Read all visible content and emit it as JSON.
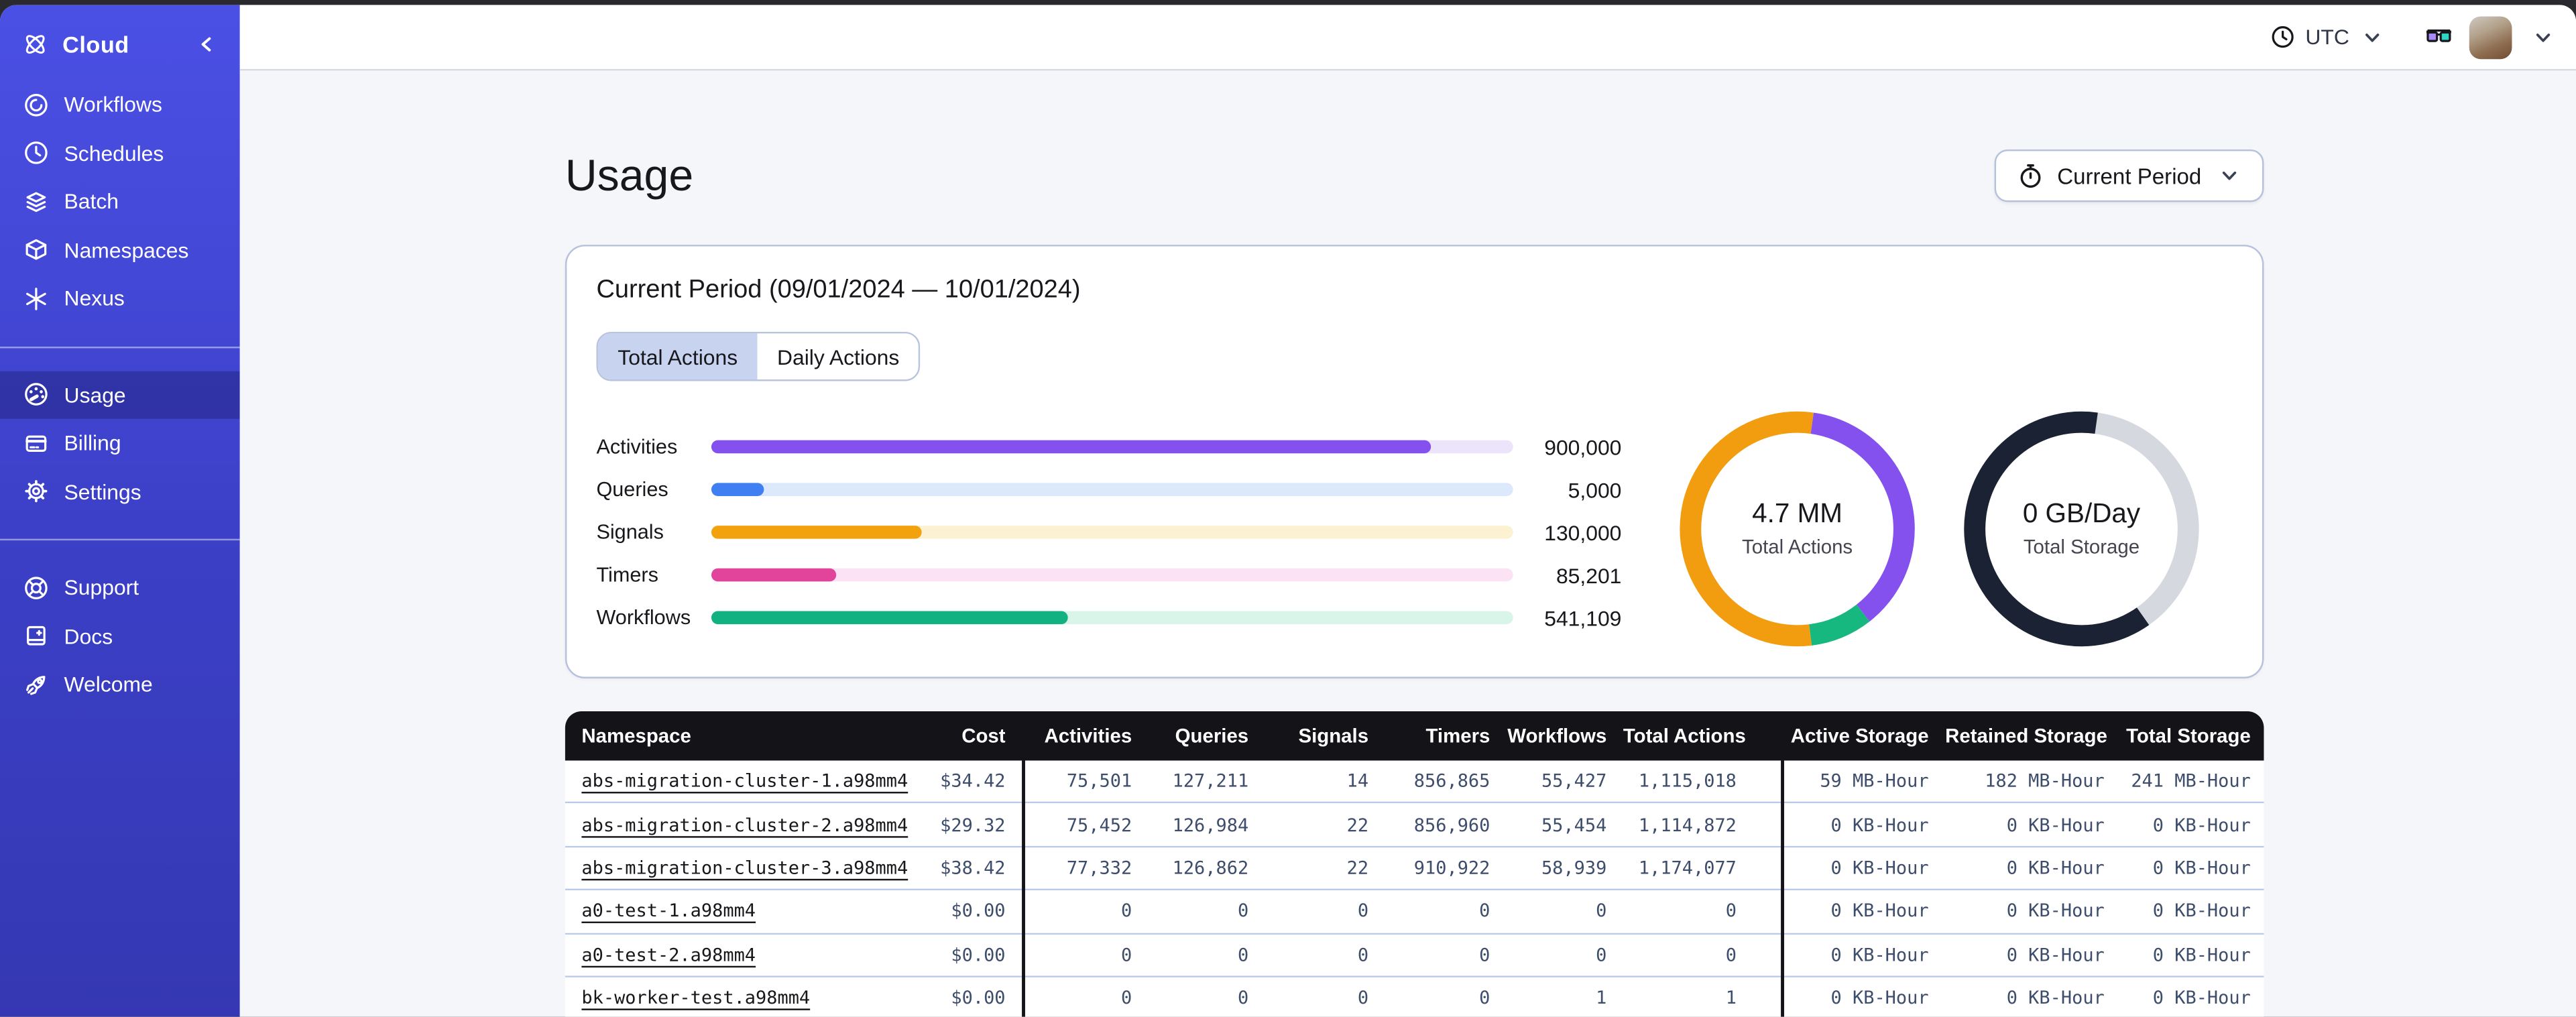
{
  "sidebar": {
    "brand": {
      "label": "Cloud"
    },
    "groups": [
      {
        "items": [
          {
            "icon": "workflows-icon",
            "label": "Workflows"
          },
          {
            "icon": "schedules-icon",
            "label": "Schedules"
          },
          {
            "icon": "batch-icon",
            "label": "Batch"
          },
          {
            "icon": "namespaces-icon",
            "label": "Namespaces"
          },
          {
            "icon": "nexus-icon",
            "label": "Nexus"
          }
        ]
      },
      {
        "items": [
          {
            "icon": "usage-icon",
            "label": "Usage",
            "active": true
          },
          {
            "icon": "billing-icon",
            "label": "Billing"
          },
          {
            "icon": "settings-icon",
            "label": "Settings"
          }
        ]
      },
      {
        "items": [
          {
            "icon": "support-icon",
            "label": "Support"
          },
          {
            "icon": "docs-icon",
            "label": "Docs"
          },
          {
            "icon": "welcome-icon",
            "label": "Welcome"
          }
        ]
      }
    ]
  },
  "topbar": {
    "timezone_label": "UTC"
  },
  "main": {
    "title": "Usage",
    "period_button_label": "Current Period",
    "panel": {
      "title": "Current Period (09/01/2024 — 10/01/2024)",
      "tabs": [
        {
          "label": "Total Actions",
          "active": true
        },
        {
          "label": "Daily Actions",
          "active": false
        }
      ],
      "bars": [
        {
          "label": "Activities",
          "value": "900,000",
          "fraction": 0.897,
          "color": "#8450EE",
          "track": "#EBE4FB"
        },
        {
          "label": "Queries",
          "value": "5,000",
          "fraction": 0.066,
          "color": "#3F7FF2",
          "track": "#DCE8FB"
        },
        {
          "label": "Signals",
          "value": "130,000",
          "fraction": 0.262,
          "color": "#F2A20D",
          "track": "#FCF2D2"
        },
        {
          "label": "Timers",
          "value": "85,201",
          "fraction": 0.156,
          "color": "#E3449B",
          "track": "#FBE3F5"
        },
        {
          "label": "Workflows",
          "value": "541,109",
          "fraction": 0.445,
          "color": "#12B181",
          "track": "#D9F5EA"
        }
      ],
      "donuts": [
        {
          "value": "4.7 MM",
          "label": "Total Actions",
          "rotation_deg": 8,
          "segments": [
            {
              "color": "#8450EE",
              "fraction": 0.372
            },
            {
              "color": "#16B87F",
              "fraction": 0.086
            },
            {
              "color": "#F29D0F",
              "fraction": 0.542
            }
          ]
        },
        {
          "value": "0 GB/Day",
          "label": "Total Storage",
          "rotation_deg": 8,
          "segments": [
            {
              "color": "#D6D8DF",
              "fraction": 0.38
            },
            {
              "color": "#1B2233",
              "fraction": 0.62
            }
          ]
        }
      ]
    },
    "table": {
      "columns": [
        "Namespace",
        "Cost",
        "Activities",
        "Queries",
        "Signals",
        "Timers",
        "Workflows",
        "Total Actions",
        "Active Storage",
        "Retained Storage",
        "Total Storage"
      ],
      "rows": [
        {
          "namespace": "abs-migration-cluster-1.a98mm4",
          "cost": "$34.42",
          "activities": "75,501",
          "queries": "127,211",
          "signals": "14",
          "timers": "856,865",
          "workflows": "55,427",
          "total_actions": "1,115,018",
          "active_storage": "59 MB-Hour",
          "retained_storage": "182 MB-Hour",
          "total_storage": "241 MB-Hour"
        },
        {
          "namespace": "abs-migration-cluster-2.a98mm4",
          "cost": "$29.32",
          "activities": "75,452",
          "queries": "126,984",
          "signals": "22",
          "timers": "856,960",
          "workflows": "55,454",
          "total_actions": "1,114,872",
          "active_storage": "0 KB-Hour",
          "retained_storage": "0 KB-Hour",
          "total_storage": "0 KB-Hour"
        },
        {
          "namespace": "abs-migration-cluster-3.a98mm4",
          "cost": "$38.42",
          "activities": "77,332",
          "queries": "126,862",
          "signals": "22",
          "timers": "910,922",
          "workflows": "58,939",
          "total_actions": "1,174,077",
          "active_storage": "0 KB-Hour",
          "retained_storage": "0 KB-Hour",
          "total_storage": "0 KB-Hour"
        },
        {
          "namespace": "a0-test-1.a98mm4",
          "cost": "$0.00",
          "activities": "0",
          "queries": "0",
          "signals": "0",
          "timers": "0",
          "workflows": "0",
          "total_actions": "0",
          "active_storage": "0 KB-Hour",
          "retained_storage": "0 KB-Hour",
          "total_storage": "0 KB-Hour"
        },
        {
          "namespace": "a0-test-2.a98mm4",
          "cost": "$0.00",
          "activities": "0",
          "queries": "0",
          "signals": "0",
          "timers": "0",
          "workflows": "0",
          "total_actions": "0",
          "active_storage": "0 KB-Hour",
          "retained_storage": "0 KB-Hour",
          "total_storage": "0 KB-Hour"
        },
        {
          "namespace": "bk-worker-test.a98mm4",
          "cost": "$0.00",
          "activities": "0",
          "queries": "0",
          "signals": "0",
          "timers": "0",
          "workflows": "1",
          "total_actions": "1",
          "active_storage": "0 KB-Hour",
          "retained_storage": "0 KB-Hour",
          "total_storage": "0 KB-Hour"
        }
      ]
    }
  }
}
